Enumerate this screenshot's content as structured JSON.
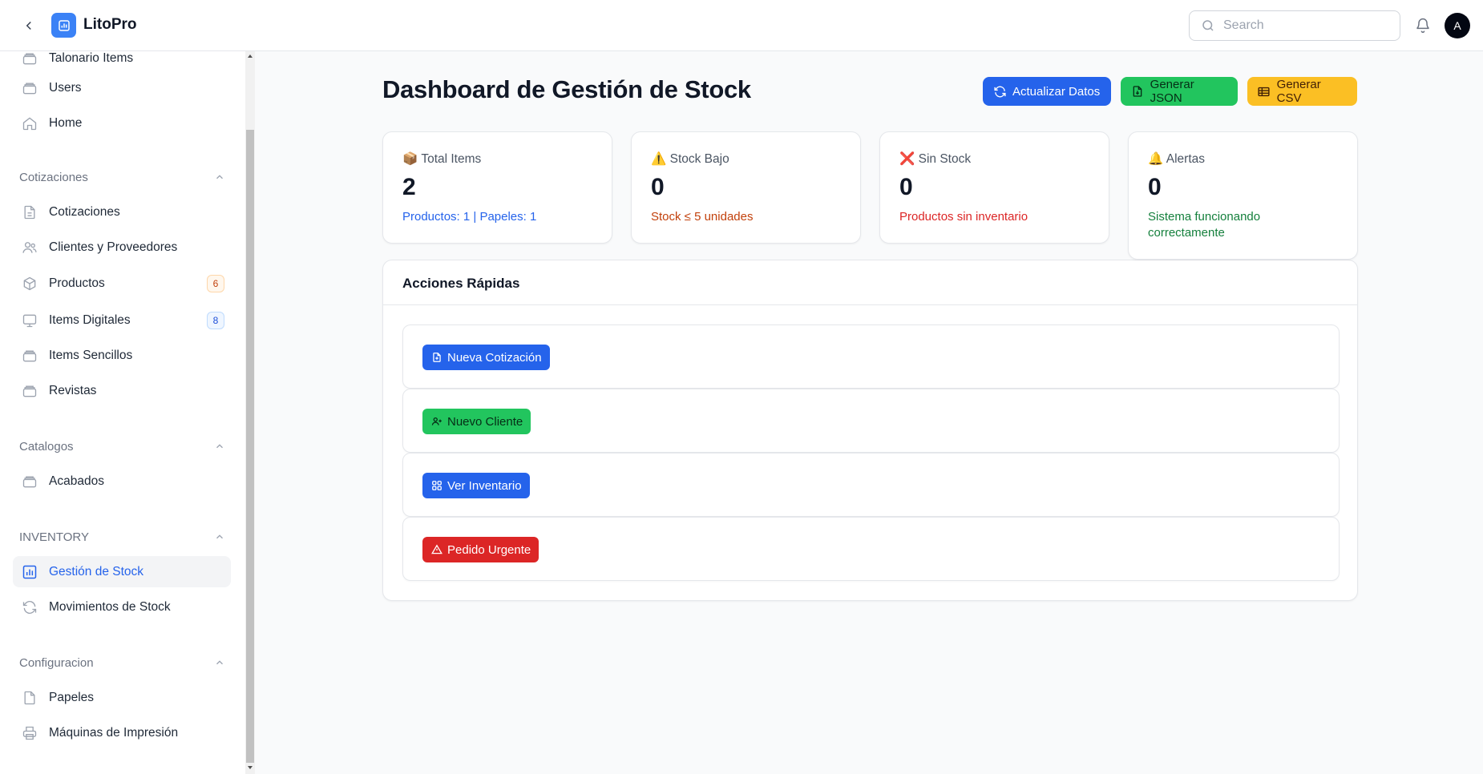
{
  "app": {
    "brand": "LitoPro"
  },
  "topbar": {
    "search_placeholder": "Search",
    "avatar_initial": "A"
  },
  "sidebar": {
    "top_items": [
      {
        "label": "Talonario Items"
      },
      {
        "label": "Users"
      },
      {
        "label": "Home"
      }
    ],
    "groups": [
      {
        "label": "Cotizaciones",
        "items": [
          {
            "label": "Cotizaciones"
          },
          {
            "label": "Clientes y Proveedores"
          },
          {
            "label": "Productos",
            "badge": "6"
          },
          {
            "label": "Items Digitales",
            "badge": "8"
          },
          {
            "label": "Items Sencillos"
          },
          {
            "label": "Revistas"
          }
        ]
      },
      {
        "label": "Catalogos",
        "items": [
          {
            "label": "Acabados"
          }
        ]
      },
      {
        "label": "INVENTORY",
        "items": [
          {
            "label": "Gestión de Stock",
            "active": true
          },
          {
            "label": "Movimientos de Stock"
          }
        ]
      },
      {
        "label": "Configuracion",
        "items": [
          {
            "label": "Papeles"
          },
          {
            "label": "Máquinas de Impresión"
          }
        ]
      }
    ]
  },
  "page": {
    "title": "Dashboard de Gestión de Stock",
    "actions": {
      "refresh": "Actualizar Datos",
      "json": "Generar JSON",
      "csv": "Generar CSV"
    }
  },
  "stats": [
    {
      "label": "📦 Total Items",
      "value": "2",
      "sub": "Productos: 1 | Papeles: 1",
      "color": "#2563eb"
    },
    {
      "label": "⚠️ Stock Bajo",
      "value": "0",
      "sub": "Stock ≤ 5 unidades",
      "color": "#c2410c"
    },
    {
      "label": "❌ Sin Stock",
      "value": "0",
      "sub": "Productos sin inventario",
      "color": "#dc2626"
    },
    {
      "label": "🔔 Alertas",
      "value": "0",
      "sub": "Sistema funcionando correctamente",
      "color": "#15803d"
    }
  ],
  "quick_actions": {
    "title": "Acciones Rápidas",
    "items": [
      {
        "label": "Nueva Cotización"
      },
      {
        "label": "Nuevo Cliente"
      },
      {
        "label": "Ver Inventario"
      },
      {
        "label": "Pedido Urgente"
      }
    ]
  },
  "colors": {
    "primary": "#2563eb",
    "success": "#22c55e",
    "warning": "#fbbf24",
    "danger": "#dc2626"
  }
}
